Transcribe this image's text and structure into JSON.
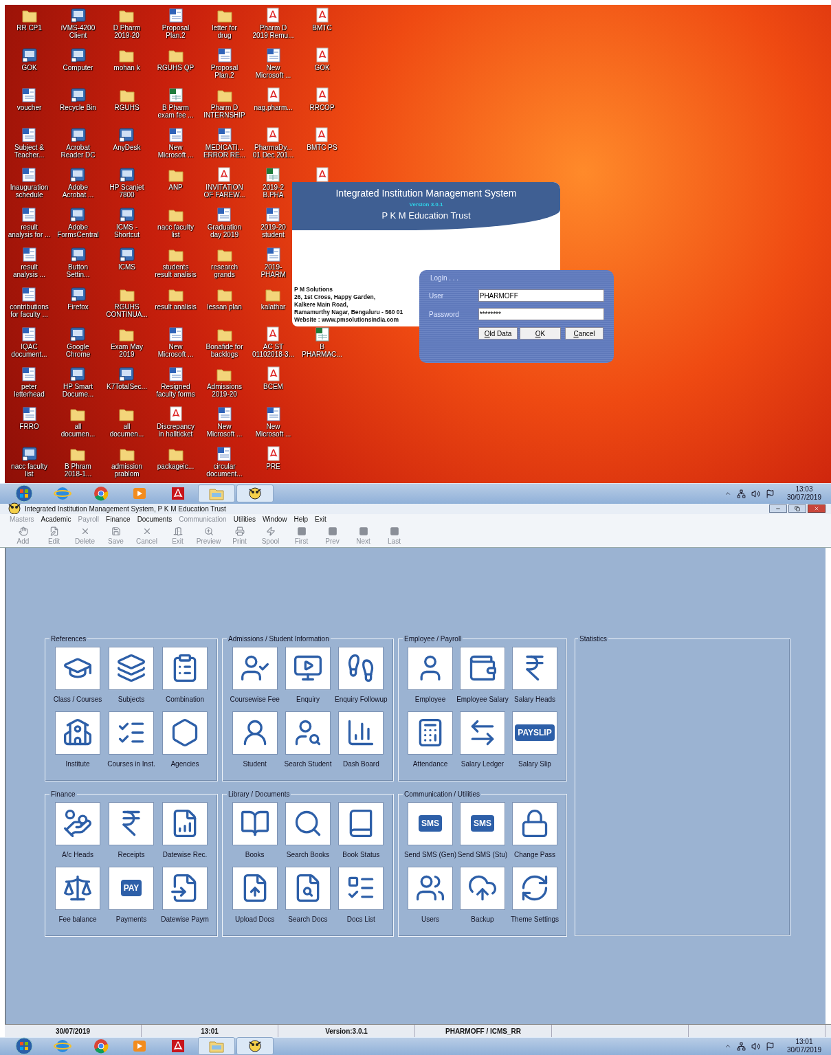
{
  "desktop": {
    "icon_rows": [
      [
        {
          "kind": "folder",
          "label": "RR CP1"
        },
        {
          "kind": "app",
          "label": "iVMS-4200\nClient"
        },
        {
          "kind": "folder",
          "label": "D Pharm\n2019-20"
        },
        {
          "kind": "doc",
          "label": "Proposal\nPlan.2"
        },
        {
          "kind": "folder",
          "label": "letter for\ndrug"
        },
        {
          "kind": "pdf",
          "label": "Pharm D\n2019 Remu..."
        },
        {
          "kind": "pdf",
          "label": "BMTC"
        }
      ],
      [
        {
          "kind": "app",
          "label": "GOK"
        },
        {
          "kind": "app",
          "label": "Computer"
        },
        {
          "kind": "folder",
          "label": "mohan k"
        },
        {
          "kind": "folder",
          "label": "RGUHS QP"
        },
        {
          "kind": "doc",
          "label": "Proposal\nPlan.2"
        },
        {
          "kind": "doc",
          "label": "New\nMicrosoft ..."
        },
        {
          "kind": "pdf",
          "label": "GOK"
        }
      ],
      [
        {
          "kind": "doc",
          "label": "voucher"
        },
        {
          "kind": "app",
          "label": "Recycle Bin"
        },
        {
          "kind": "folder",
          "label": "RGUHS"
        },
        {
          "kind": "sheet",
          "label": "B Pharm\nexam fee ..."
        },
        {
          "kind": "folder",
          "label": "Pharm D\nINTERNSHIP"
        },
        {
          "kind": "pdf",
          "label": "nag.pharm..."
        },
        {
          "kind": "pdf",
          "label": "RRCOP"
        }
      ],
      [
        {
          "kind": "doc",
          "label": "Subject &\nTeacher..."
        },
        {
          "kind": "app",
          "label": "Acrobat\nReader DC"
        },
        {
          "kind": "app",
          "label": "AnyDesk"
        },
        {
          "kind": "doc",
          "label": "New\nMicrosoft ..."
        },
        {
          "kind": "doc",
          "label": "MEDICATI...\nERROR RE..."
        },
        {
          "kind": "pdf",
          "label": "PharmaDy...\n01 Dec 201..."
        },
        {
          "kind": "pdf",
          "label": "BMTC PS"
        }
      ],
      [
        {
          "kind": "doc",
          "label": "Inauguration\nschedule"
        },
        {
          "kind": "app",
          "label": "Adobe\nAcrobat ..."
        },
        {
          "kind": "app",
          "label": "HP Scanjet\n7800"
        },
        {
          "kind": "folder",
          "label": "ANP"
        },
        {
          "kind": "pdf",
          "label": "INVITATION\nOF FAREW..."
        },
        {
          "kind": "sheet",
          "label": "2019-2\nB.PHA"
        },
        {
          "kind": "pdf"
        }
      ],
      [
        {
          "kind": "doc",
          "label": "result\nanalysis for ..."
        },
        {
          "kind": "app",
          "label": "Adobe\nFormsCentral"
        },
        {
          "kind": "app",
          "label": "ICMS -\nShortcut"
        },
        {
          "kind": "folder",
          "label": "nacc faculty\nlist"
        },
        {
          "kind": "doc",
          "label": "Graduation\nday 2019"
        },
        {
          "kind": "doc",
          "label": "2019-20\nstudent"
        }
      ],
      [
        {
          "kind": "doc",
          "label": "result\nanalysis ..."
        },
        {
          "kind": "app",
          "label": "Button\nSettin..."
        },
        {
          "kind": "app",
          "label": "ICMS"
        },
        {
          "kind": "folder",
          "label": "students\nresult analisis"
        },
        {
          "kind": "folder",
          "label": "research\ngrands"
        },
        {
          "kind": "doc",
          "label": "2019-\nPHARM"
        }
      ],
      [
        {
          "kind": "doc",
          "label": "contributions\nfor faculty ..."
        },
        {
          "kind": "app",
          "label": "Firefox"
        },
        {
          "kind": "folder",
          "label": "RGUHS\nCONTINUA..."
        },
        {
          "kind": "folder",
          "label": "result analisis"
        },
        {
          "kind": "folder",
          "label": "lessan plan"
        },
        {
          "kind": "folder",
          "label": "kalathar"
        }
      ],
      [
        {
          "kind": "doc",
          "label": "IQAC\ndocument..."
        },
        {
          "kind": "app",
          "label": "Google\nChrome"
        },
        {
          "kind": "folder",
          "label": "Exam May\n2019"
        },
        {
          "kind": "doc",
          "label": "New\nMicrosoft ..."
        },
        {
          "kind": "folder",
          "label": "Bonafide for\nbacklogs"
        },
        {
          "kind": "pdf",
          "label": "AC ST\n01102018-3..."
        },
        {
          "kind": "sheet",
          "label": "B\nPHARMAC..."
        }
      ],
      [
        {
          "kind": "doc",
          "label": "peter\nletterhead"
        },
        {
          "kind": "app",
          "label": "HP Smart\nDocume..."
        },
        {
          "kind": "app",
          "label": "K7TotalSec..."
        },
        {
          "kind": "doc",
          "label": "Resigned\nfaculty forms"
        },
        {
          "kind": "folder",
          "label": "Admissions\n2019-20"
        },
        {
          "kind": "pdf",
          "label": "BCEM"
        }
      ],
      [
        {
          "kind": "doc",
          "label": "FRRO"
        },
        {
          "kind": "folder",
          "label": "all\ndocumen..."
        },
        {
          "kind": "folder",
          "label": "all\ndocumen..."
        },
        {
          "kind": "pdf",
          "label": "Discrepancy\nin hallticket"
        },
        {
          "kind": "doc",
          "label": "New\nMicrosoft ..."
        },
        {
          "kind": "doc",
          "label": "New\nMicrosoft ..."
        }
      ],
      [
        {
          "kind": "app",
          "label": "nacc faculty\nlist"
        },
        {
          "kind": "folder",
          "label": "B Phram\n2018-1..."
        },
        {
          "kind": "folder",
          "label": "admission\nprablom"
        },
        {
          "kind": "folder",
          "label": "packageic..."
        },
        {
          "kind": "doc",
          "label": "circular\ndocument..."
        },
        {
          "kind": "pdf",
          "label": "PRE"
        }
      ]
    ]
  },
  "splash": {
    "title": "Integrated Institution Management System",
    "version": "Version 3.0.1",
    "organization": "P K M Education Trust",
    "address": [
      "P M Solutions",
      "26, 1st Cross, Happy Garden,",
      "Kalkere Main Road,",
      "Ramamurthy Nagar, Bengaluru - 560 01",
      "Website : www.pmsolutionsindia.com"
    ]
  },
  "login": {
    "heading": "Login . . .",
    "user_label": "User",
    "user_value": "PHARMOFF",
    "password_label": "Password",
    "password_value": "********",
    "buttons": [
      "Old Data",
      "OK",
      "Cancel"
    ]
  },
  "taskbar_top": {
    "items": [
      {
        "kind": "start",
        "selected": false
      },
      {
        "kind": "ie",
        "selected": false
      },
      {
        "kind": "chrome",
        "selected": false
      },
      {
        "kind": "media",
        "selected": false
      },
      {
        "kind": "acrobat",
        "selected": false
      },
      {
        "kind": "explorer",
        "selected": true
      },
      {
        "kind": "icms",
        "selected": true
      }
    ],
    "time": "13:03",
    "date": "30/07/2019"
  },
  "app": {
    "title": "Integrated Institution Management System, P K M Education Trust",
    "menu": [
      {
        "label": "Masters",
        "disabled": true
      },
      {
        "label": "Academic",
        "disabled": false
      },
      {
        "label": "Payroll",
        "disabled": true
      },
      {
        "label": "Finance",
        "disabled": false
      },
      {
        "label": "Documents",
        "disabled": false
      },
      {
        "label": "Communication",
        "disabled": true
      },
      {
        "label": "Utilities",
        "disabled": false
      },
      {
        "label": "Window",
        "disabled": false
      },
      {
        "label": "Help",
        "disabled": false
      },
      {
        "label": "Exit",
        "disabled": false
      }
    ],
    "toolbar": [
      {
        "label": "Add",
        "disabled": true
      },
      {
        "label": "Edit",
        "disabled": true
      },
      {
        "label": "Delete",
        "disabled": true
      },
      {
        "label": "Save",
        "disabled": true
      },
      {
        "label": "Cancel",
        "disabled": true
      },
      {
        "label": "Exit",
        "disabled": true
      },
      {
        "label": "Preview",
        "disabled": true
      },
      {
        "label": "Print",
        "disabled": true
      },
      {
        "label": "Spool",
        "disabled": true
      },
      {
        "label": "First",
        "disabled": true
      },
      {
        "label": "Prev",
        "disabled": true
      },
      {
        "label": "Next",
        "disabled": true
      },
      {
        "label": "Last",
        "disabled": true
      }
    ],
    "groups": [
      {
        "title": "References",
        "tiles": [
          {
            "label": "Class / Courses"
          },
          {
            "label": "Subjects"
          },
          {
            "label": "Combination"
          },
          {
            "label": "Institute"
          },
          {
            "label": "Courses in Inst."
          },
          {
            "label": "Agencies"
          }
        ]
      },
      {
        "title": "Admissions / Student Information",
        "tiles": [
          {
            "label": "Coursewise Fee"
          },
          {
            "label": "Enquiry"
          },
          {
            "label": "Enquiry Followup"
          },
          {
            "label": "Student"
          },
          {
            "label": "Search Student"
          },
          {
            "label": "Dash Board"
          }
        ]
      },
      {
        "title": "Employee / Payroll",
        "tiles": [
          {
            "label": "Employee"
          },
          {
            "label": "Employee Salary"
          },
          {
            "label": "Salary Heads"
          },
          {
            "label": "Attendance"
          },
          {
            "label": "Salary Ledger"
          },
          {
            "label": "Salary Slip",
            "icon_text": "PAYSLIP"
          }
        ]
      },
      {
        "title": "Finance",
        "tiles": [
          {
            "label": "A/c Heads"
          },
          {
            "label": "Receipts"
          },
          {
            "label": "Datewise Rec."
          },
          {
            "label": "Fee balance"
          },
          {
            "label": "Payments",
            "icon_text": "PAY"
          },
          {
            "label": "Datewise Paym"
          }
        ]
      },
      {
        "title": "Library / Documents",
        "tiles": [
          {
            "label": "Books"
          },
          {
            "label": "Search Books"
          },
          {
            "label": "Book Status"
          },
          {
            "label": "Upload Docs"
          },
          {
            "label": "Search Docs"
          },
          {
            "label": "Docs List"
          }
        ]
      },
      {
        "title": "Communication / Utilities",
        "tiles": [
          {
            "label": "Send SMS (Gen)",
            "icon_text": "SMS"
          },
          {
            "label": "Send SMS (Stu)",
            "icon_text": "SMS"
          },
          {
            "label": "Change Pass"
          },
          {
            "label": "Users"
          },
          {
            "label": "Backup"
          },
          {
            "label": "Theme Settings"
          }
        ]
      }
    ],
    "statistics": {
      "title": "Statistics"
    },
    "status_bar": [
      "30/07/2019",
      "13:01",
      "Version:3.0.1",
      "PHARMOFF / ICMS_RR"
    ]
  },
  "taskbar_bottom": {
    "items": [
      {
        "kind": "start",
        "selected": false
      },
      {
        "kind": "ie",
        "selected": false
      },
      {
        "kind": "chrome",
        "selected": false
      },
      {
        "kind": "media",
        "selected": false
      },
      {
        "kind": "acrobat",
        "selected": false
      },
      {
        "kind": "explorer",
        "selected": true
      },
      {
        "kind": "icms",
        "selected": true
      }
    ],
    "time": "13:01",
    "date": "30/07/2019"
  }
}
